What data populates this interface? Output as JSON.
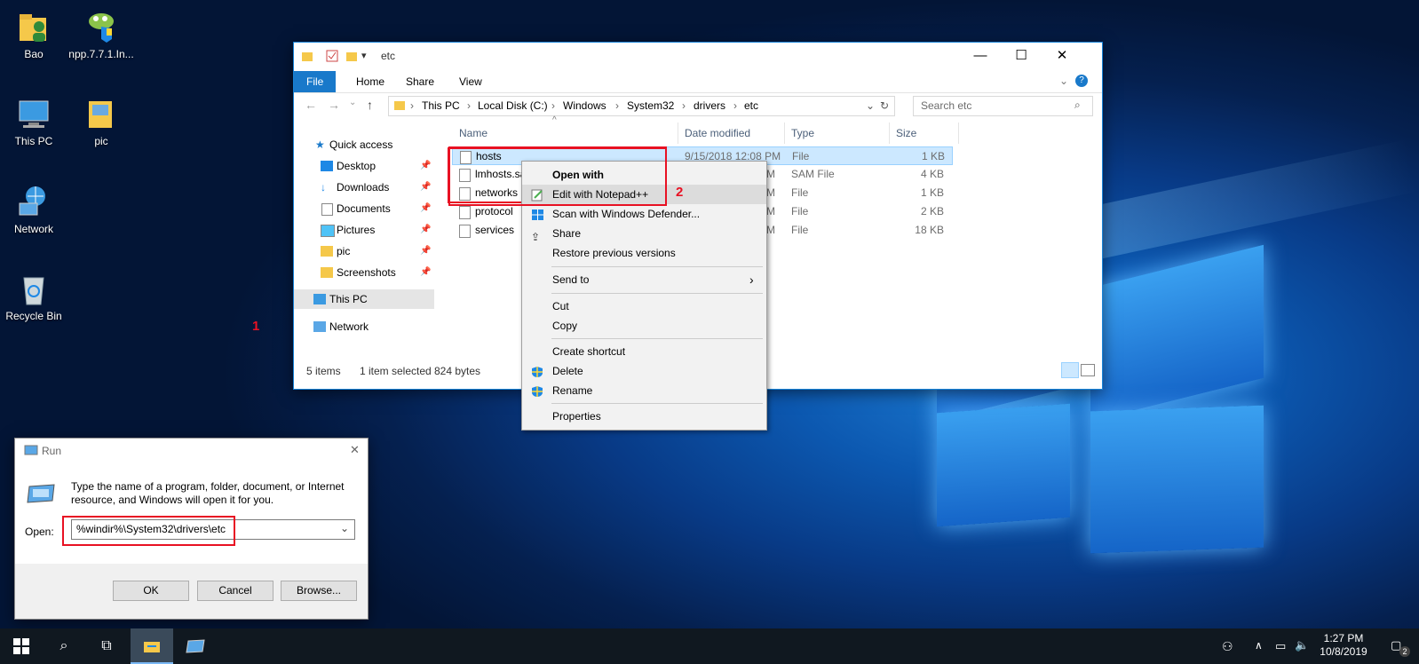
{
  "desktop": {
    "icons": [
      {
        "label": "Bao",
        "icon": "user-folder-icon"
      },
      {
        "label": "npp.7.7.1.In...",
        "icon": "notepadpp-installer-icon"
      },
      {
        "label": "This PC",
        "icon": "this-pc-icon"
      },
      {
        "label": "pic",
        "icon": "folder-icon"
      },
      {
        "label": "Network",
        "icon": "network-icon"
      },
      {
        "label": "Recycle Bin",
        "icon": "recycle-bin-icon"
      }
    ],
    "step1": "1",
    "step2": "2"
  },
  "explorer": {
    "title": "etc",
    "ribbon_tabs": [
      "File",
      "Home",
      "Share",
      "View"
    ],
    "breadcrumb": [
      "This PC",
      "Local Disk (C:)",
      "Windows",
      "System32",
      "drivers",
      "etc"
    ],
    "search_placeholder": "Search etc",
    "nav": {
      "quick_access": "Quick access",
      "items": [
        "Desktop",
        "Downloads",
        "Documents",
        "Pictures",
        "pic",
        "Screenshots"
      ],
      "this_pc": "This PC",
      "network": "Network"
    },
    "columns": [
      "Name",
      "Date modified",
      "Type",
      "Size"
    ],
    "files": [
      {
        "name": "hosts",
        "date": "9/15/2018 12:08 PM",
        "type": "File",
        "size": "1 KB"
      },
      {
        "name": "lmhosts.sa",
        "date": "M",
        "type": "SAM File",
        "size": "4 KB"
      },
      {
        "name": "networks",
        "date": "M",
        "type": "File",
        "size": "1 KB"
      },
      {
        "name": "protocol",
        "date": "M",
        "type": "File",
        "size": "2 KB"
      },
      {
        "name": "services",
        "date": "M",
        "type": "File",
        "size": "18 KB"
      }
    ],
    "status": {
      "items": "5 items",
      "selected": "1 item selected",
      "size": "824 bytes"
    }
  },
  "context_menu": {
    "open_with": "Open with",
    "edit_npp": "Edit with Notepad++",
    "scan": "Scan with Windows Defender...",
    "share": "Share",
    "restore": "Restore previous versions",
    "send_to": "Send to",
    "cut": "Cut",
    "copy": "Copy",
    "create_shortcut": "Create shortcut",
    "delete": "Delete",
    "rename": "Rename",
    "properties": "Properties"
  },
  "run": {
    "title": "Run",
    "description": "Type the name of a program, folder, document, or Internet resource, and Windows will open it for you.",
    "open_label": "Open:",
    "open_value": "%windir%\\System32\\drivers\\etc",
    "ok": "OK",
    "cancel": "Cancel",
    "browse": "Browse..."
  },
  "taskbar": {
    "time": "1:27 PM",
    "date": "10/8/2019",
    "notifications": "2"
  },
  "colors": {
    "accent": "#1979ca",
    "highlight": "#e81123",
    "selection": "#cce8ff"
  }
}
